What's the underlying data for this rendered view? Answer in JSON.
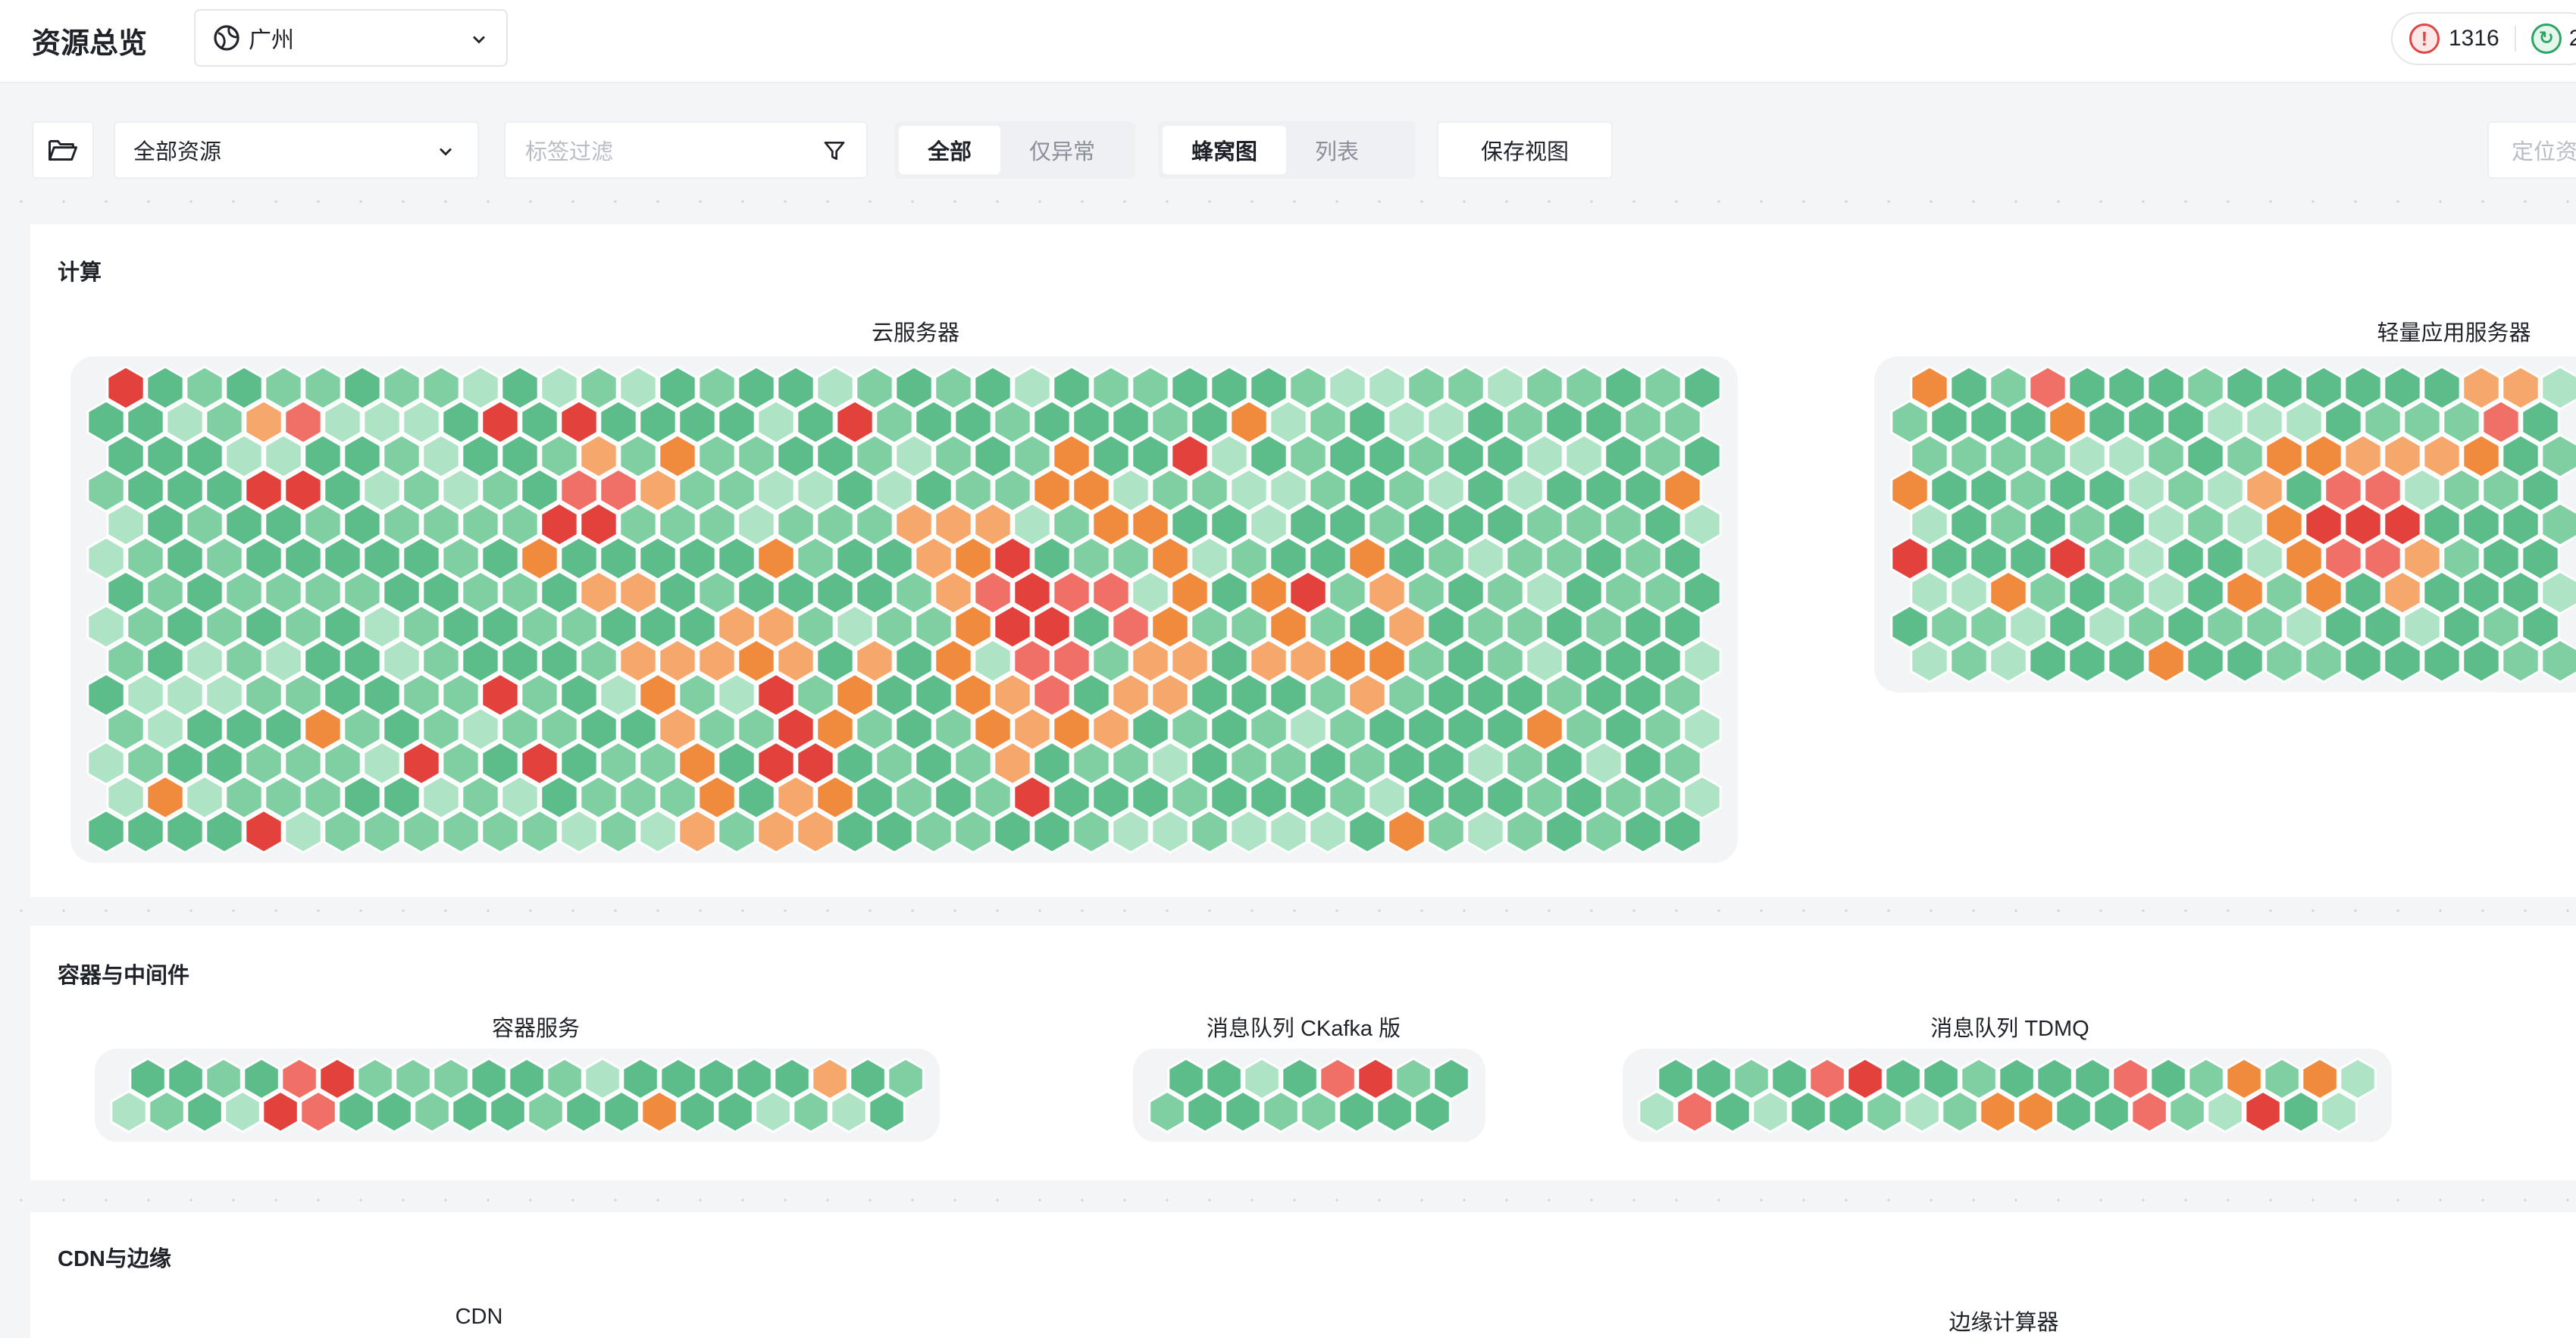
{
  "header": {
    "title": "资源总览",
    "region": "广州",
    "alert_count": "1316",
    "ok_count": "2"
  },
  "toolbar": {
    "resource_select": "全部资源",
    "tag_filter_placeholder": "标签过滤",
    "filter_all": "全部",
    "filter_abnormal": "仅异常",
    "view_honeycomb": "蜂窝图",
    "view_list": "列表",
    "save_view": "保存视图",
    "locate_placeholder": "定位资"
  },
  "sections": [
    {
      "title": "计算",
      "groups": [
        {
          "label": "云服务器"
        },
        {
          "label": "轻量应用服务器"
        }
      ]
    },
    {
      "title": "容器与中间件",
      "groups": [
        {
          "label": "容器服务"
        },
        {
          "label": "消息队列 CKafka 版"
        },
        {
          "label": "消息队列 TDMQ"
        }
      ]
    },
    {
      "title": "CDN与边缘",
      "groups": [
        {
          "label": "CDN"
        },
        {
          "label": "边缘计算器"
        }
      ]
    }
  ],
  "colors": {
    "healthy_dark": "#5cbd8a",
    "healthy_mid": "#7fcfa2",
    "healthy_light": "#aee3c5",
    "warn": "#f08a3c",
    "warn_light": "#f6a76b",
    "danger": "#e3413b",
    "danger_light": "#f07068",
    "background": "#f4f5f7"
  }
}
